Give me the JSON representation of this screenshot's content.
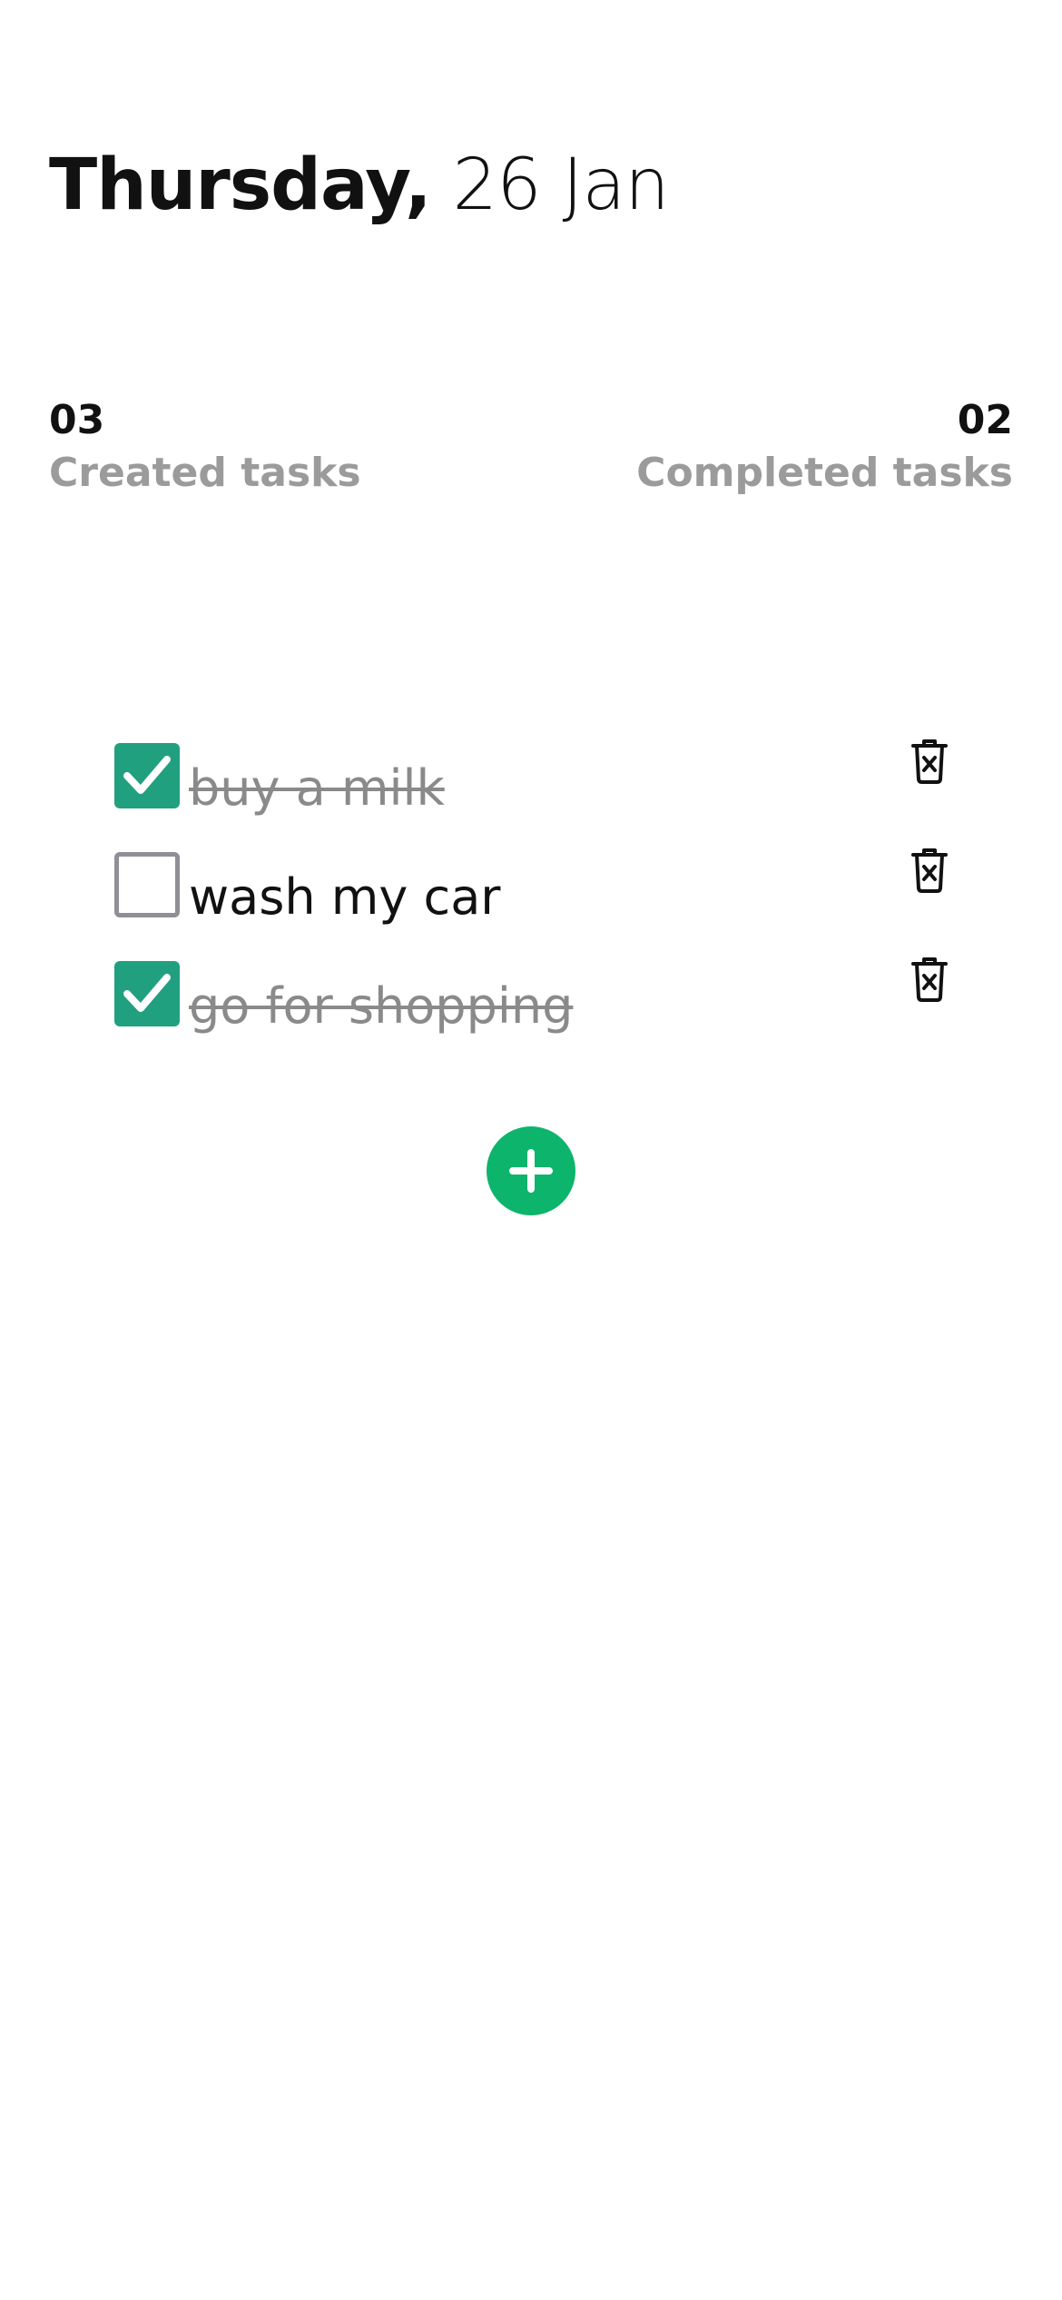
{
  "header": {
    "day": "Thursday,",
    "date": "26 Jan"
  },
  "stats": {
    "created_count": "03",
    "created_label": "Created tasks",
    "completed_count": "02",
    "completed_label": "Completed tasks"
  },
  "tasks": [
    {
      "label": "buy a milk",
      "completed": true
    },
    {
      "label": "wash my car",
      "completed": false
    },
    {
      "label": "go for shopping",
      "completed": true
    }
  ],
  "icons": {
    "checkbox": "check-icon",
    "delete": "trash-icon",
    "add": "plus-icon"
  },
  "colors": {
    "checked": "#20a07f",
    "unchecked_border": "#8f8f97",
    "add_button": "#0db46c",
    "muted_text": "#9b9b9b"
  }
}
